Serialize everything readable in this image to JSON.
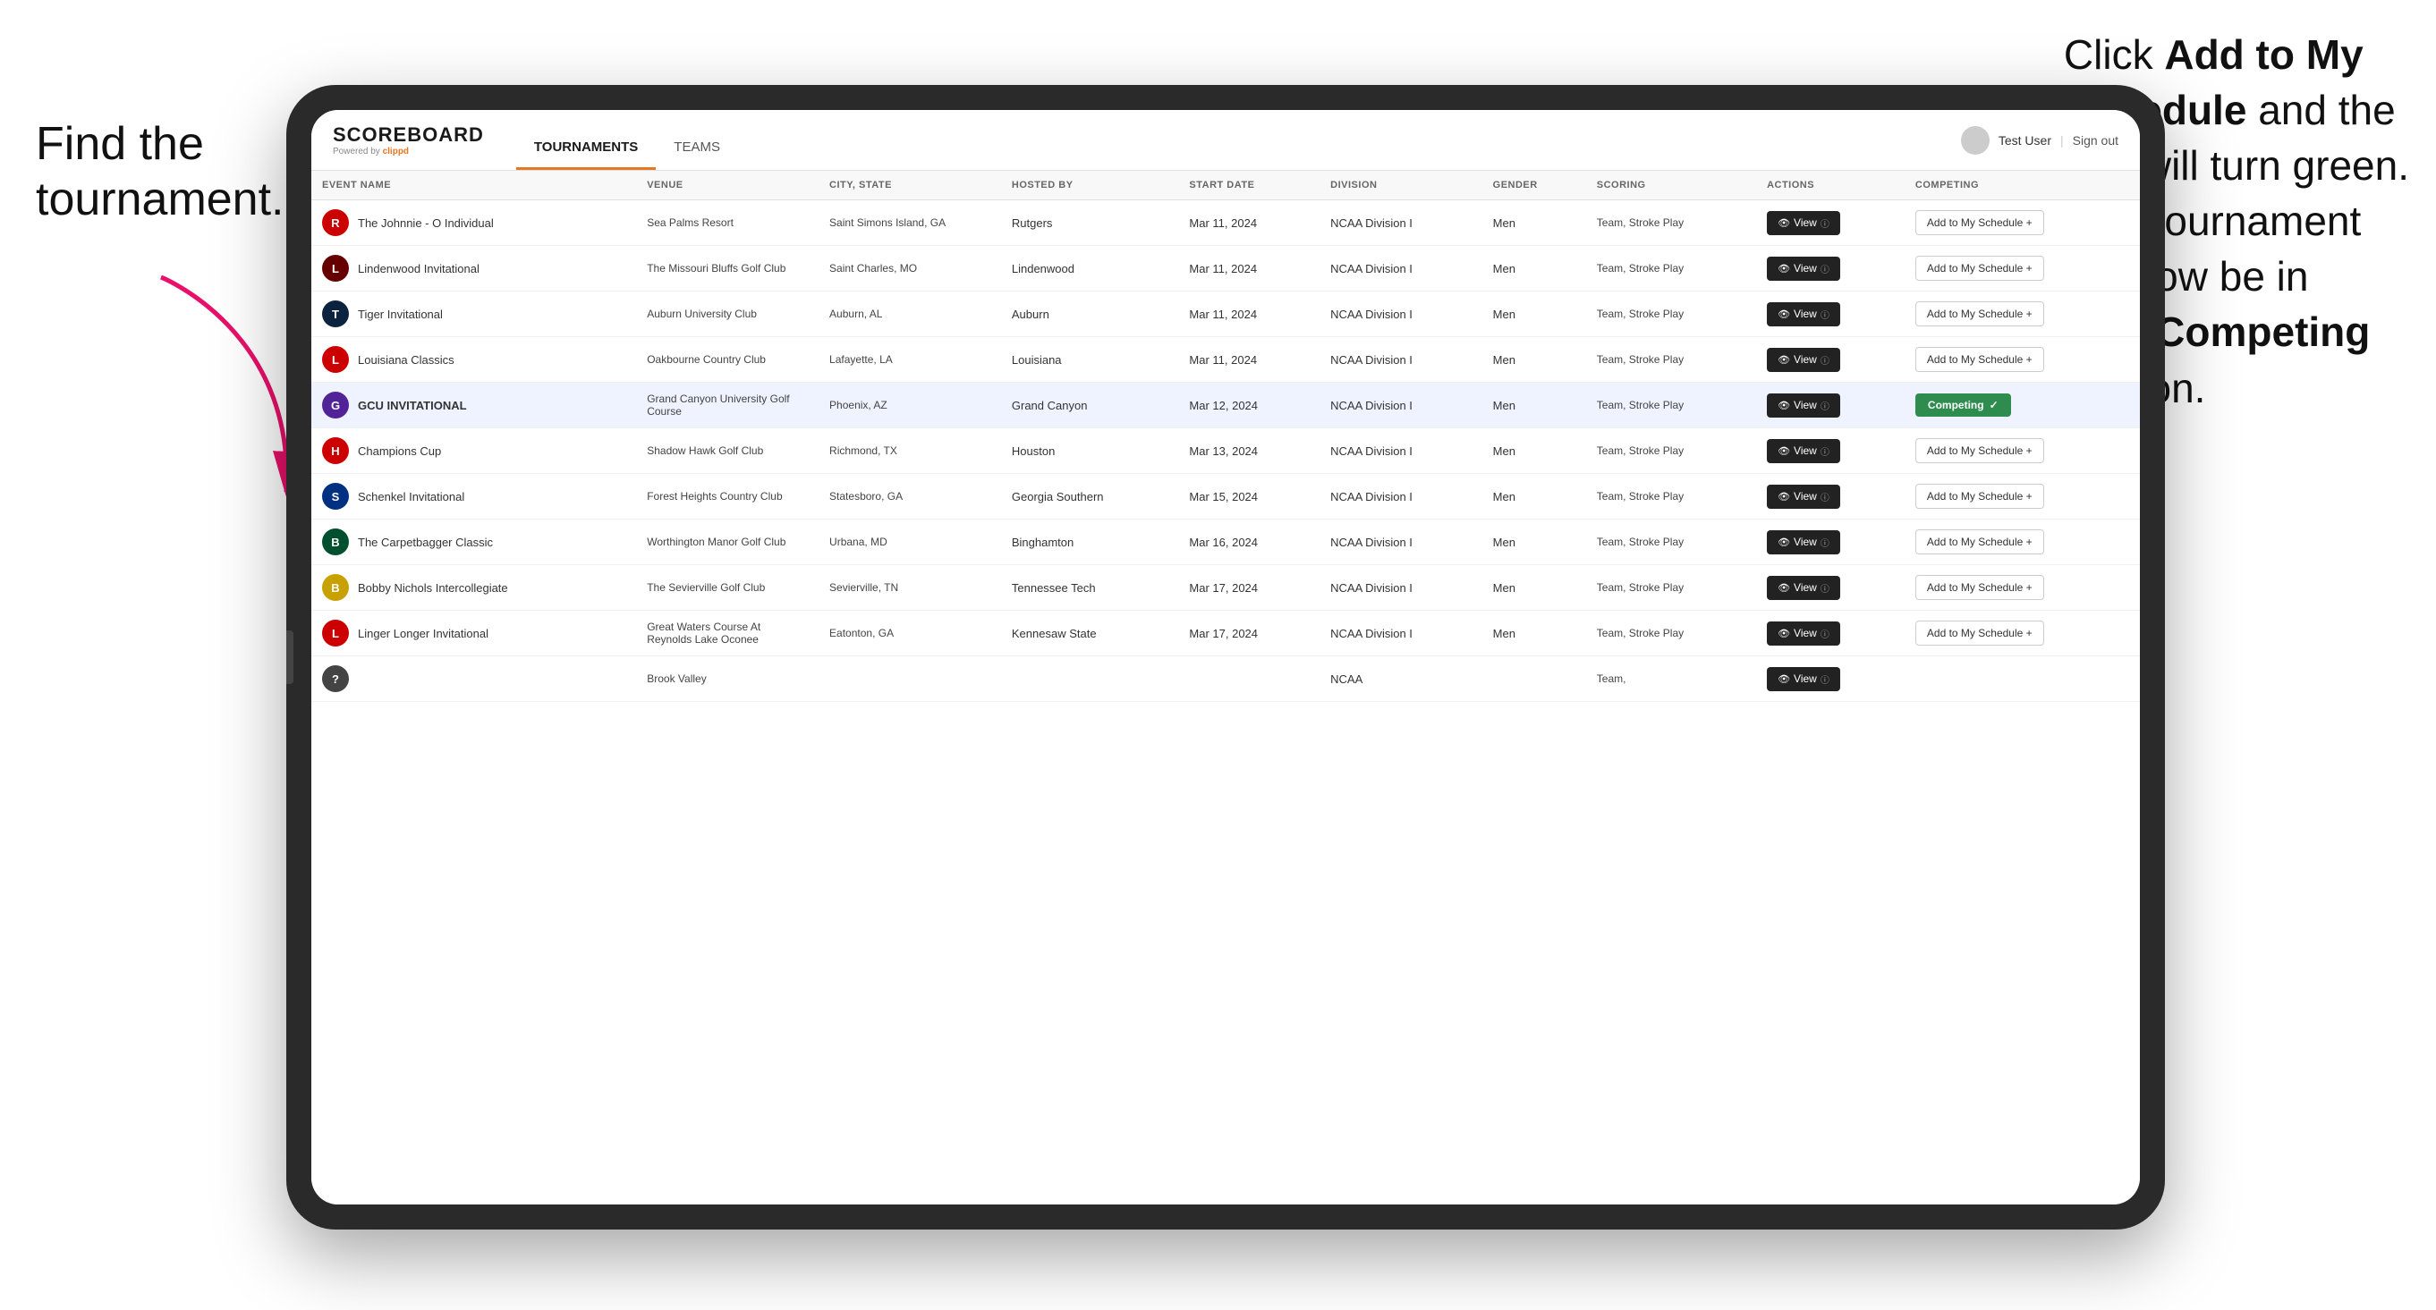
{
  "annotations": {
    "left": "Find the\ntournament.",
    "right_part1": "Click ",
    "right_bold1": "Add to My\nSchedule",
    "right_part2": " and the\nbox will turn green.\nThis tournament\nwill now be in\nyour ",
    "right_bold2": "Competing",
    "right_part3": "\nsection."
  },
  "header": {
    "logo": "SCOREBOARD",
    "powered_by": "Powered by clippd",
    "nav_tabs": [
      "TOURNAMENTS",
      "TEAMS"
    ],
    "active_tab": "TOURNAMENTS",
    "user": "Test User",
    "sign_out": "Sign out"
  },
  "table": {
    "columns": [
      "EVENT NAME",
      "VENUE",
      "CITY, STATE",
      "HOSTED BY",
      "START DATE",
      "DIVISION",
      "GENDER",
      "SCORING",
      "ACTIONS",
      "COMPETING"
    ],
    "rows": [
      {
        "logo_color": "#cc0000",
        "logo_letter": "R",
        "event": "The Johnnie - O Individual",
        "venue": "Sea Palms Resort",
        "city": "Saint Simons Island, GA",
        "hosted_by": "Rutgers",
        "start_date": "Mar 11, 2024",
        "division": "NCAA Division I",
        "gender": "Men",
        "scoring": "Team, Stroke Play",
        "action": "View",
        "competing": "Add to My Schedule +",
        "is_competing": false,
        "highlighted": false
      },
      {
        "logo_color": "#660000",
        "logo_letter": "L",
        "event": "Lindenwood Invitational",
        "venue": "The Missouri Bluffs Golf Club",
        "city": "Saint Charles, MO",
        "hosted_by": "Lindenwood",
        "start_date": "Mar 11, 2024",
        "division": "NCAA Division I",
        "gender": "Men",
        "scoring": "Team, Stroke Play",
        "action": "View",
        "competing": "Add to My Schedule +",
        "is_competing": false,
        "highlighted": false
      },
      {
        "logo_color": "#0c2340",
        "logo_letter": "T",
        "event": "Tiger Invitational",
        "venue": "Auburn University Club",
        "city": "Auburn, AL",
        "hosted_by": "Auburn",
        "start_date": "Mar 11, 2024",
        "division": "NCAA Division I",
        "gender": "Men",
        "scoring": "Team, Stroke Play",
        "action": "View",
        "competing": "Add to My Schedule +",
        "is_competing": false,
        "highlighted": false
      },
      {
        "logo_color": "#cc0000",
        "logo_letter": "L",
        "event": "Louisiana Classics",
        "venue": "Oakbourne Country Club",
        "city": "Lafayette, LA",
        "hosted_by": "Louisiana",
        "start_date": "Mar 11, 2024",
        "division": "NCAA Division I",
        "gender": "Men",
        "scoring": "Team, Stroke Play",
        "action": "View",
        "competing": "Add to My Schedule +",
        "is_competing": false,
        "highlighted": false
      },
      {
        "logo_color": "#522398",
        "logo_letter": "G",
        "event": "GCU INVITATIONAL",
        "venue": "Grand Canyon University Golf Course",
        "city": "Phoenix, AZ",
        "hosted_by": "Grand Canyon",
        "start_date": "Mar 12, 2024",
        "division": "NCAA Division I",
        "gender": "Men",
        "scoring": "Team, Stroke Play",
        "action": "View",
        "competing": "Competing ✓",
        "is_competing": true,
        "highlighted": true
      },
      {
        "logo_color": "#cc0000",
        "logo_letter": "H",
        "event": "Champions Cup",
        "venue": "Shadow Hawk Golf Club",
        "city": "Richmond, TX",
        "hosted_by": "Houston",
        "start_date": "Mar 13, 2024",
        "division": "NCAA Division I",
        "gender": "Men",
        "scoring": "Team, Stroke Play",
        "action": "View",
        "competing": "Add to My Schedule +",
        "is_competing": false,
        "highlighted": false
      },
      {
        "logo_color": "#003082",
        "logo_letter": "S",
        "event": "Schenkel Invitational",
        "venue": "Forest Heights Country Club",
        "city": "Statesboro, GA",
        "hosted_by": "Georgia Southern",
        "start_date": "Mar 15, 2024",
        "division": "NCAA Division I",
        "gender": "Men",
        "scoring": "Team, Stroke Play",
        "action": "View",
        "competing": "Add to My Schedule +",
        "is_competing": false,
        "highlighted": false
      },
      {
        "logo_color": "#005030",
        "logo_letter": "B",
        "event": "The Carpetbagger Classic",
        "venue": "Worthington Manor Golf Club",
        "city": "Urbana, MD",
        "hosted_by": "Binghamton",
        "start_date": "Mar 16, 2024",
        "division": "NCAA Division I",
        "gender": "Men",
        "scoring": "Team, Stroke Play",
        "action": "View",
        "competing": "Add to My Schedule +",
        "is_competing": false,
        "highlighted": false
      },
      {
        "logo_color": "#c8a000",
        "logo_letter": "B",
        "event": "Bobby Nichols Intercollegiate",
        "venue": "The Sevierville Golf Club",
        "city": "Sevierville, TN",
        "hosted_by": "Tennessee Tech",
        "start_date": "Mar 17, 2024",
        "division": "NCAA Division I",
        "gender": "Men",
        "scoring": "Team, Stroke Play",
        "action": "View",
        "competing": "Add to My Schedule +",
        "is_competing": false,
        "highlighted": false
      },
      {
        "logo_color": "#cc0000",
        "logo_letter": "L",
        "event": "Linger Longer Invitational",
        "venue": "Great Waters Course At Reynolds Lake Oconee",
        "city": "Eatonton, GA",
        "hosted_by": "Kennesaw State",
        "start_date": "Mar 17, 2024",
        "division": "NCAA Division I",
        "gender": "Men",
        "scoring": "Team, Stroke Play",
        "action": "View",
        "competing": "Add to My Schedule +",
        "is_competing": false,
        "highlighted": false
      },
      {
        "logo_color": "#444",
        "logo_letter": "?",
        "event": "",
        "venue": "Brook Valley",
        "city": "",
        "hosted_by": "",
        "start_date": "",
        "division": "NCAA",
        "gender": "",
        "scoring": "Team,",
        "action": "View",
        "competing": "",
        "is_competing": false,
        "highlighted": false,
        "partial": true
      }
    ]
  }
}
